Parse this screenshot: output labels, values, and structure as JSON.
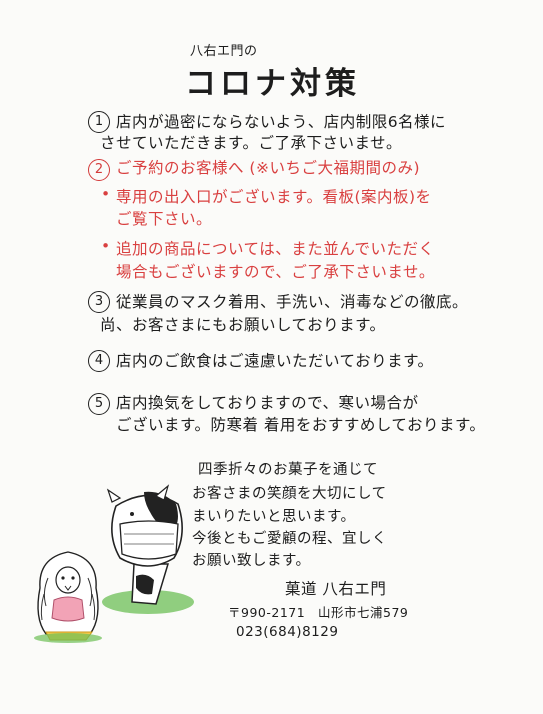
{
  "header": {
    "shop_small": "八右エ門の",
    "title": "コロナ対策"
  },
  "items": [
    {
      "number": "1",
      "lines": [
        "店内が過密にならないよう、店内制限6名様に",
        "させていただきます。ご了承下さいませ。"
      ]
    },
    {
      "number": "2",
      "heading": "ご予約のお客様へ (※いちご大福期間のみ)",
      "bullets": [
        {
          "lines": [
            "専用の出入口がございます。看板(案内板)を",
            "ご覧下さい。"
          ]
        },
        {
          "lines": [
            "追加の商品については、また並んでいただく",
            "場合もございますので、ご了承下さいませ。"
          ]
        }
      ]
    },
    {
      "number": "3",
      "lines": [
        "従業員のマスク着用、手洗い、消毒などの徹底。",
        "尚、お客さまにもお願いしております。"
      ]
    },
    {
      "number": "4",
      "lines": [
        "店内のご飲食はご遠慮いただいております。"
      ]
    },
    {
      "number": "5",
      "lines": [
        "店内換気をしておりますので、寒い場合が",
        "ございます。防寒着 着用をおすすめしております。"
      ]
    }
  ],
  "closing": {
    "lines": [
      "四季折々のお菓子を通じて",
      "お客さまの笑顔を大切にして",
      "まいりたいと思います。",
      "今後ともご愛顧の程、宜しく",
      "お願い致します。"
    ]
  },
  "signature": "菓道 八右エ門",
  "address": {
    "postal": "〒990-2171",
    "location": "山形市七浦579",
    "phone": "023(684)8129"
  },
  "colors": {
    "accent_red": "#d94040",
    "ink": "#1d1d1d",
    "paper": "#fbfbf9",
    "grass": "#5aa84a"
  }
}
